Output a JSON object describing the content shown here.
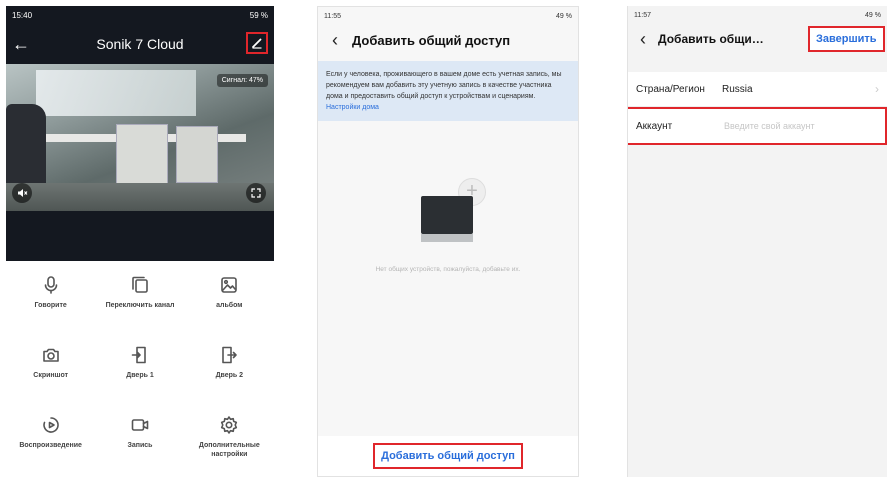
{
  "phone1": {
    "status_time": "15:40",
    "status_right": "59 %",
    "title": "Sonik 7 Cloud",
    "signal": "Сигнал: 47%",
    "controls": [
      {
        "label": "Говорите",
        "icon": "microphone-icon"
      },
      {
        "label": "Переключить канал",
        "icon": "switch-channel-icon"
      },
      {
        "label": "альбом",
        "icon": "album-icon"
      },
      {
        "label": "Скриншот",
        "icon": "camera-icon"
      },
      {
        "label": "Дверь 1",
        "icon": "door-1-icon"
      },
      {
        "label": "Дверь 2",
        "icon": "door-2-icon"
      },
      {
        "label": "Воспроизведение",
        "icon": "playback-icon"
      },
      {
        "label": "Запись",
        "icon": "video-record-icon"
      },
      {
        "label": "Дополнительные настройки",
        "icon": "gear-icon"
      }
    ]
  },
  "phone2": {
    "status_time": "11:55",
    "status_right": "49 %",
    "title": "Добавить общий доступ",
    "info_text": "Если у человека, проживающего в вашем доме есть учетная запись, мы рекомендуем вам добавить эту учетную запись в качестве участника дома и предоставить общий доступ к устройствам и сценариям.",
    "info_link": "Настройки дома",
    "empty_text": "Нет общих устройств, пожалуйста, добавьте их.",
    "add_button": "Добавить общий доступ"
  },
  "phone3": {
    "status_time": "11:57",
    "status_right": "49 %",
    "title": "Добавить общий д...",
    "done_button": "Завершить",
    "country_label": "Страна/Регион",
    "country_value": "Russia",
    "account_label": "Аккаунт",
    "account_placeholder": "Введите свой аккаунт"
  }
}
